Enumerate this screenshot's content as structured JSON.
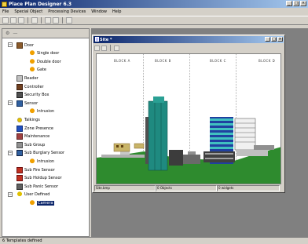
{
  "app": {
    "title": "Place Plan Designer 6.3"
  },
  "menu": [
    "File",
    "Special Object",
    "Processing Devices",
    "Window",
    "Help"
  ],
  "tree": {
    "items": [
      {
        "label": "Door",
        "level": 1,
        "icon": "door-icon",
        "expander": "−"
      },
      {
        "label": "Single door",
        "level": 2,
        "icon": "bell-icon"
      },
      {
        "label": "Double door",
        "level": 2,
        "icon": "bell-icon"
      },
      {
        "label": "Gate",
        "level": 2,
        "icon": "bell-icon"
      },
      {
        "label": "Reader",
        "level": 1,
        "icon": "reader-icon"
      },
      {
        "label": "Controller",
        "level": 1,
        "icon": "controller-icon"
      },
      {
        "label": "Security Box",
        "level": 1,
        "icon": "security-box-icon"
      },
      {
        "label": "Sensor",
        "level": 1,
        "icon": "sensor-icon",
        "expander": "−"
      },
      {
        "label": "Intrusion",
        "level": 2,
        "icon": "bell-icon"
      },
      {
        "label": "Talkings",
        "level": 1,
        "icon": "talking-icon"
      },
      {
        "label": "Zone Presence",
        "level": 1,
        "icon": "zone-icon"
      },
      {
        "label": "Maintenance",
        "level": 1,
        "icon": "maintenance-icon"
      },
      {
        "label": "Sub Group",
        "level": 1,
        "icon": "group-icon"
      },
      {
        "label": "Sub Burglary Sensor",
        "level": 1,
        "icon": "burglary-icon",
        "expander": "−"
      },
      {
        "label": "Intrusion",
        "level": 2,
        "icon": "bell-icon"
      },
      {
        "label": "Sub Fire Sensor",
        "level": 1,
        "icon": "fire-icon"
      },
      {
        "label": "Sub Holdup Sensor",
        "level": 1,
        "icon": "holdup-icon"
      },
      {
        "label": "Sub Panic Sensor",
        "level": 1,
        "icon": "panic-icon"
      },
      {
        "label": "User Defined",
        "level": 1,
        "icon": "user-defined-icon",
        "expander": "−"
      },
      {
        "label": "Camera",
        "level": 2,
        "icon": "bell-icon",
        "selected": true
      }
    ]
  },
  "status": {
    "text": "6 Templates defined"
  },
  "child": {
    "title": "Site *",
    "blocks": [
      "BLOCK A",
      "BLOCK B",
      "BLOCK C",
      "BLOCK D"
    ],
    "status": [
      "Site.bmp",
      "0 Objects",
      "0 widgets"
    ]
  },
  "colors": {
    "titlebar": "#0a246a",
    "ground": "#2e8b2e",
    "teal": "#1f8a80",
    "highlight": "#0a246a"
  }
}
